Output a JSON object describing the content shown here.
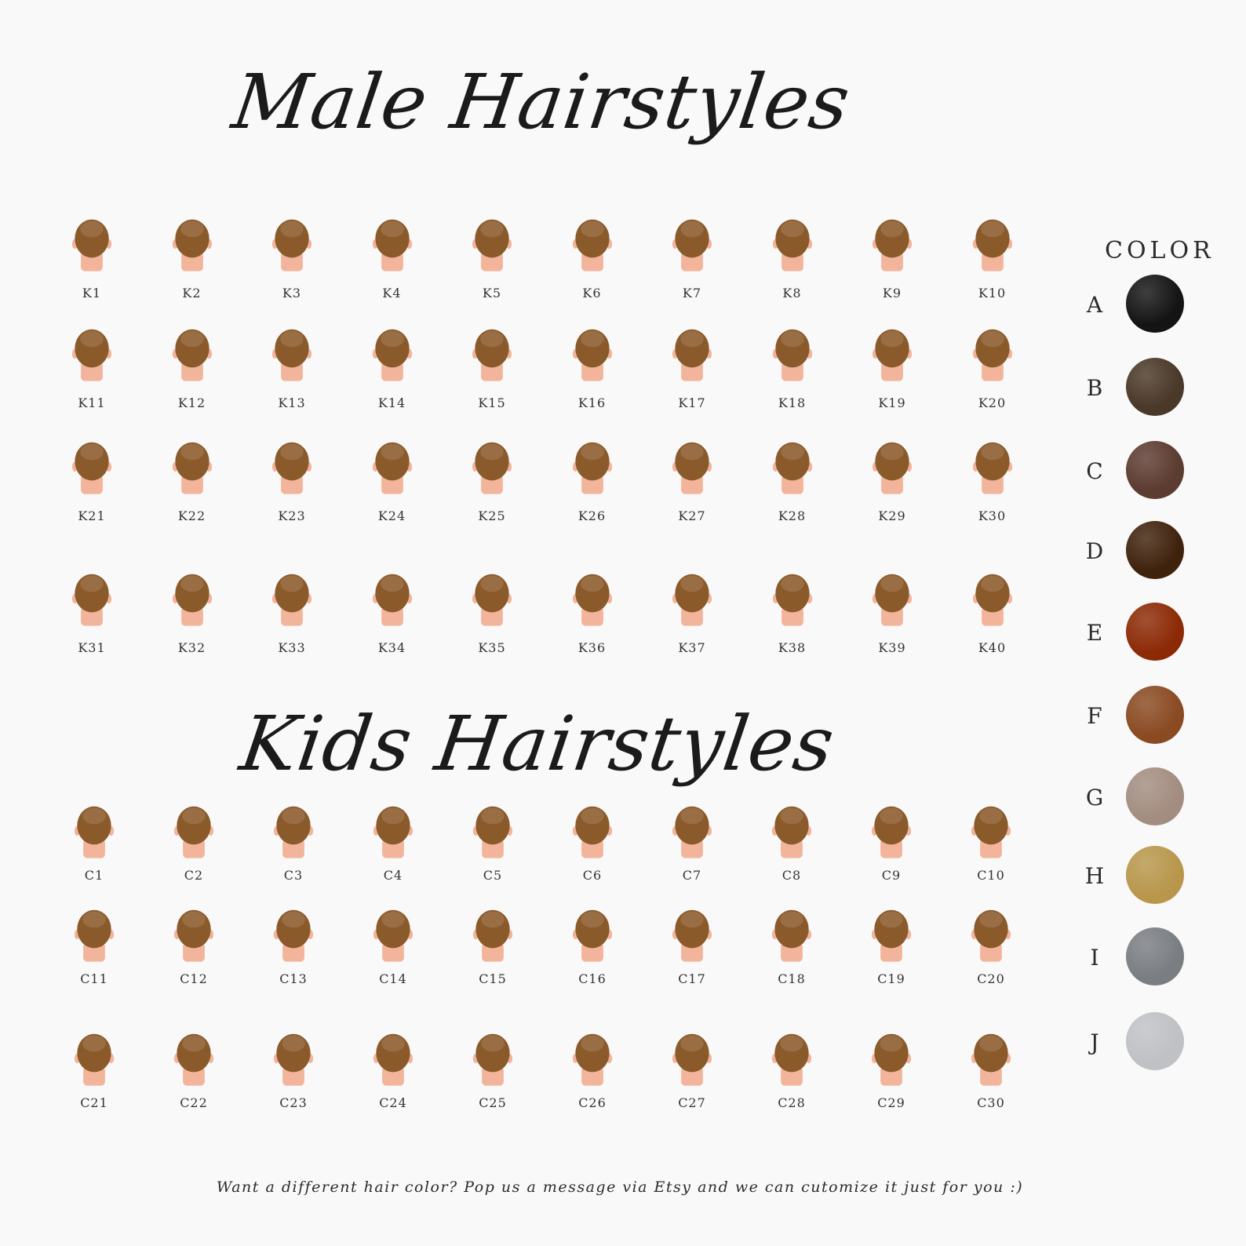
{
  "male_title": "Male Hairstyles",
  "kids_title": "Kids Hairstyles",
  "color_title": "COLOR",
  "male_styles": [
    "K1",
    "K2",
    "K3",
    "K4",
    "K5",
    "K6",
    "K7",
    "K8",
    "K9",
    "K10",
    "K11",
    "K12",
    "K13",
    "K14",
    "K15",
    "K16",
    "K17",
    "K18",
    "K19",
    "K20",
    "K21",
    "K22",
    "K23",
    "K24",
    "K25",
    "K26",
    "K27",
    "K28",
    "K29",
    "K30",
    "K31",
    "K32",
    "K33",
    "K34",
    "K35",
    "K36",
    "K37",
    "K38",
    "K39",
    "K40"
  ],
  "kids_styles": [
    "C1",
    "C2",
    "C3",
    "C4",
    "C5",
    "C6",
    "C7",
    "C8",
    "C9",
    "C10",
    "C11",
    "C12",
    "C13",
    "C14",
    "C15",
    "C16",
    "C17",
    "C18",
    "C19",
    "C20",
    "C21",
    "C22",
    "C23",
    "C24",
    "C25",
    "C26",
    "C27",
    "C28",
    "C29",
    "C30"
  ],
  "colors": [
    {
      "letter": "A",
      "hex": "#141414"
    },
    {
      "letter": "B",
      "hex": "#4a3828"
    },
    {
      "letter": "C",
      "hex": "#5c3b30"
    },
    {
      "letter": "D",
      "hex": "#3f220c"
    },
    {
      "letter": "E",
      "hex": "#8c2a06"
    },
    {
      "letter": "F",
      "hex": "#8a4a22"
    },
    {
      "letter": "G",
      "hex": "#a38d80"
    },
    {
      "letter": "H",
      "hex": "#b8974c"
    },
    {
      "letter": "I",
      "hex": "#7a7d82"
    },
    {
      "letter": "J",
      "hex": "#bfc1c4"
    }
  ],
  "hair_color": "#8b5a2b",
  "skin_color": "#f2b49a",
  "footer_note": "Want a different hair color? Pop us a message via Etsy and we can cutomize it just for you :)"
}
